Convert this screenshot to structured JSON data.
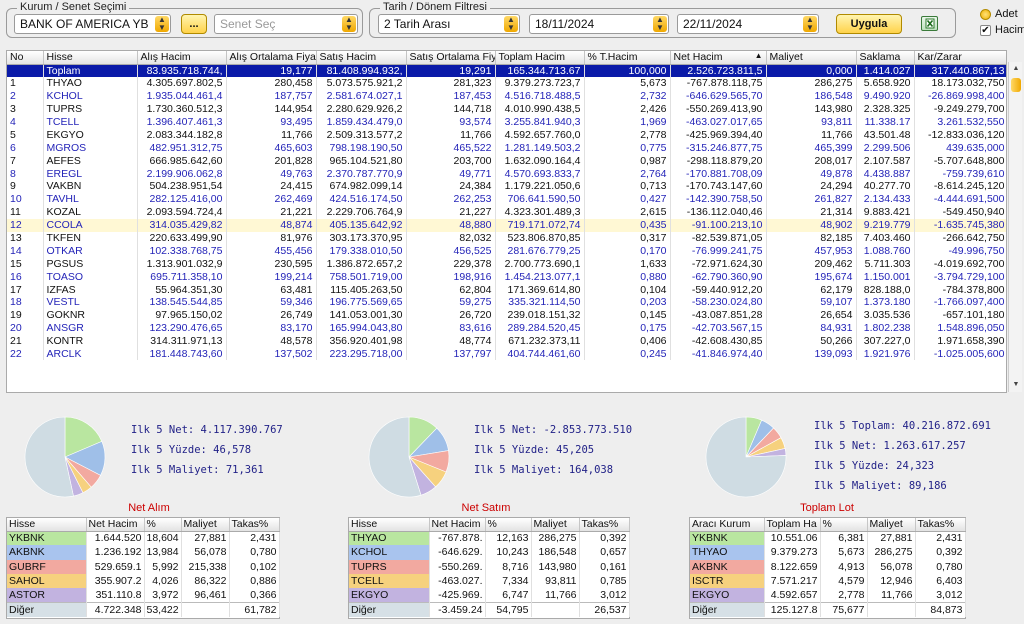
{
  "filters": {
    "kurum_legend": "Kurum / Senet Seçimi",
    "kurum_value": "BANK OF AMERICA YB",
    "dots_label": "...",
    "senet_placeholder": "Senet Seç",
    "tarih_legend": "Tarih / Dönem Filtresi",
    "range_value": "2 Tarih Arası",
    "date_from": "18/11/2024",
    "date_to": "22/11/2024",
    "apply_label": "Uygula"
  },
  "options": {
    "adet_label": "Adet",
    "hacim_label": "Hacim",
    "hacim_checked": "✔"
  },
  "grid": {
    "headers": [
      "No",
      "Hisse",
      "Alış Hacim",
      "Alış Ortalama Fiya",
      "Satış Hacim",
      "Satış Ortalama Fiy",
      "Toplam Hacim",
      "% T.Hacim",
      "Net Hacim",
      "Maliyet",
      "Saklama",
      "Kar/Zarar"
    ],
    "sort_indicator": "▲",
    "total": [
      "",
      "Toplam",
      "83.935.718.744,",
      "19,177",
      "81.408.994.932,",
      "19,291",
      "165.344.713.67",
      "100,000",
      "2.526.723.811,5",
      "0,000",
      "1.414.027",
      "317.440.867,13"
    ],
    "rows": [
      [
        "1",
        "THYAO",
        "4.305.697.802,5",
        "280,458",
        "5.073.575.921,2",
        "281,323",
        "9.379.273.723,7",
        "5,673",
        "-767.878.118,75",
        "286,275",
        "5.658.920",
        "18.173.032,750"
      ],
      [
        "2",
        "KCHOL",
        "1.935.044.461,4",
        "187,757",
        "2.581.674.027,1",
        "187,453",
        "4.516.718.488,5",
        "2,732",
        "-646.629.565,70",
        "186,548",
        "9.490.920",
        "-26.869.998,400"
      ],
      [
        "3",
        "TUPRS",
        "1.730.360.512,3",
        "144,954",
        "2.280.629.926,2",
        "144,718",
        "4.010.990.438,5",
        "2,426",
        "-550.269.413,90",
        "143,980",
        "2.328.325",
        "-9.249.279,700"
      ],
      [
        "4",
        "TCELL",
        "1.396.407.461,3",
        "93,495",
        "1.859.434.479,0",
        "93,574",
        "3.255.841.940,3",
        "1,969",
        "-463.027.017,65",
        "93,811",
        "11.338.17",
        "3.261.532,550"
      ],
      [
        "5",
        "EKGYO",
        "2.083.344.182,8",
        "11,766",
        "2.509.313.577,2",
        "11,766",
        "4.592.657.760,0",
        "2,778",
        "-425.969.394,40",
        "11,766",
        "43.501.48",
        "-12.833.036,120"
      ],
      [
        "6",
        "MGROS",
        "482.951.312,75",
        "465,603",
        "798.198.190,50",
        "465,522",
        "1.281.149.503,2",
        "0,775",
        "-315.246.877,75",
        "465,399",
        "2.299.506",
        "439.635,000"
      ],
      [
        "7",
        "AEFES",
        "666.985.642,60",
        "201,828",
        "965.104.521,80",
        "203,700",
        "1.632.090.164,4",
        "0,987",
        "-298.118.879,20",
        "208,017",
        "2.107.587",
        "-5.707.648,800"
      ],
      [
        "8",
        "EREGL",
        "2.199.906.062,8",
        "49,763",
        "2.370.787.770,9",
        "49,771",
        "4.570.693.833,7",
        "2,764",
        "-170.881.708,09",
        "49,878",
        "4.438.887",
        "-759.739,610"
      ],
      [
        "9",
        "VAKBN",
        "504.238.951,54",
        "24,415",
        "674.982.099,14",
        "24,384",
        "1.179.221.050,6",
        "0,713",
        "-170.743.147,60",
        "24,294",
        "40.277.70",
        "-8.614.245,120"
      ],
      [
        "10",
        "TAVHL",
        "282.125.416,00",
        "262,469",
        "424.516.174,50",
        "262,253",
        "706.641.590,50",
        "0,427",
        "-142.390.758,50",
        "261,827",
        "2.134.433",
        "-4.444.691,500"
      ],
      [
        "11",
        "KOZAL",
        "2.093.594.724,4",
        "21,221",
        "2.229.706.764,9",
        "21,227",
        "4.323.301.489,3",
        "2,615",
        "-136.112.040,46",
        "21,314",
        "9.883.421",
        "-549.450,940"
      ],
      [
        "12",
        "CCOLA",
        "314.035.429,82",
        "48,874",
        "405.135.642,92",
        "48,880",
        "719.171.072,74",
        "0,435",
        "-91.100.213,10",
        "48,902",
        "9.219.779",
        "-1.635.745,380"
      ],
      [
        "13",
        "TKFEN",
        "220.633.499,90",
        "81,976",
        "303.173.370,95",
        "82,032",
        "523.806.870,85",
        "0,317",
        "-82.539.871,05",
        "82,185",
        "7.403.460",
        "-266.642,750"
      ],
      [
        "14",
        "OTKAR",
        "102.338.768,75",
        "455,456",
        "179.338.010,50",
        "456,525",
        "281.676.779,25",
        "0,170",
        "-76.999.241,75",
        "457,953",
        "1.088.760",
        "-49.996,750"
      ],
      [
        "15",
        "PGSUS",
        "1.313.901.032,9",
        "230,595",
        "1.386.872.657,2",
        "229,378",
        "2.700.773.690,1",
        "1,633",
        "-72.971.624,30",
        "209,462",
        "5.711.303",
        "-4.019.692,700"
      ],
      [
        "16",
        "TOASO",
        "695.711.358,10",
        "199,214",
        "758.501.719,00",
        "198,916",
        "1.454.213.077,1",
        "0,880",
        "-62.790.360,90",
        "195,674",
        "1.150.001",
        "-3.794.729,100"
      ],
      [
        "17",
        "IZFAS",
        "55.964.351,30",
        "63,481",
        "115.405.263,50",
        "62,804",
        "171.369.614,80",
        "0,104",
        "-59.440.912,20",
        "62,179",
        "828.188,0",
        "-784.378,800"
      ],
      [
        "18",
        "VESTL",
        "138.545.544,85",
        "59,346",
        "196.775.569,65",
        "59,275",
        "335.321.114,50",
        "0,203",
        "-58.230.024,80",
        "59,107",
        "1.373.180",
        "-1.766.097,400"
      ],
      [
        "19",
        "GOKNR",
        "97.965.150,02",
        "26,749",
        "141.053.001,30",
        "26,720",
        "239.018.151,32",
        "0,145",
        "-43.087.851,28",
        "26,654",
        "3.035.536",
        "-657.101,180"
      ],
      [
        "20",
        "ANSGR",
        "123.290.476,65",
        "83,170",
        "165.994.043,80",
        "83,616",
        "289.284.520,45",
        "0,175",
        "-42.703.567,15",
        "84,931",
        "1.802.238",
        "1.548.896,050"
      ],
      [
        "21",
        "KONTR",
        "314.311.971,13",
        "48,578",
        "356.920.401,98",
        "48,774",
        "671.232.373,11",
        "0,406",
        "-42.608.430,85",
        "50,266",
        "307.227,0",
        "1.971.658,390"
      ],
      [
        "22",
        "ARCLK",
        "181.448.743,60",
        "137,502",
        "223.295.718,00",
        "137,797",
        "404.744.461,60",
        "0,245",
        "-41.846.974,40",
        "139,093",
        "1.921.976",
        "-1.025.005,600"
      ]
    ]
  },
  "panels": [
    {
      "title": "Net Alım",
      "stats": [
        "Ilk 5 Net: 4.117.390.767",
        "Ilk 5 Yüzde: 46,578",
        "Ilk 5 Maliyet: 71,361"
      ],
      "pie": [
        18.6,
        14.0,
        6.0,
        4.0,
        4.0,
        53.4
      ],
      "headers": [
        "Hisse",
        "Net Hacim",
        "%",
        "Maliyet",
        "Takas%"
      ],
      "rows": [
        [
          "YKBNK",
          "1.644.520",
          "18,604",
          "27,881",
          "2,431"
        ],
        [
          "AKBNK",
          "1.236.192",
          "13,984",
          "56,078",
          "0,780"
        ],
        [
          "GUBRF",
          "529.659.1",
          "5,992",
          "215,338",
          "0,102"
        ],
        [
          "SAHOL",
          "355.907.2",
          "4,026",
          "86,322",
          "0,886"
        ],
        [
          "ASTOR",
          "351.110.8",
          "3,972",
          "96,461",
          "0,366"
        ],
        [
          "Diğer",
          "4.722.348",
          "53,422",
          "",
          "61,782"
        ]
      ]
    },
    {
      "title": "Net Satım",
      "stats": [
        "Ilk 5 Net: -2.853.773.510",
        "Ilk 5 Yüzde: 45,205",
        "Ilk 5 Maliyet: 164,038"
      ],
      "pie": [
        12.2,
        10.2,
        8.7,
        7.3,
        6.7,
        54.8
      ],
      "headers": [
        "Hisse",
        "Net Hacim",
        "%",
        "Maliyet",
        "Takas%"
      ],
      "rows": [
        [
          "THYAO",
          "-767.878.",
          "12,163",
          "286,275",
          "0,392"
        ],
        [
          "KCHOL",
          "-646.629.",
          "10,243",
          "186,548",
          "0,657"
        ],
        [
          "TUPRS",
          "-550.269.",
          "8,716",
          "143,980",
          "0,161"
        ],
        [
          "TCELL",
          "-463.027.",
          "7,334",
          "93,811",
          "0,785"
        ],
        [
          "EKGYO",
          "-425.969.",
          "6,747",
          "11,766",
          "3,012"
        ],
        [
          "Diğer",
          "-3.459.24",
          "54,795",
          "",
          "26,537"
        ]
      ]
    },
    {
      "title": "Toplam Lot",
      "stats": [
        "Ilk 5 Toplam: 40.216.872.691",
        "Ilk 5 Net: 1.263.617.257",
        "Ilk 5 Yüzde: 24,323",
        "Ilk 5 Maliyet: 89,186"
      ],
      "pie": [
        6.4,
        5.7,
        4.9,
        4.6,
        2.8,
        75.7
      ],
      "headers": [
        "Aracı Kurum",
        "Toplam Ha",
        "%",
        "Maliyet",
        "Takas%"
      ],
      "rows": [
        [
          "YKBNK",
          "10.551.06",
          "6,381",
          "27,881",
          "2,431"
        ],
        [
          "THYAO",
          "9.379.273",
          "5,673",
          "286,275",
          "0,392"
        ],
        [
          "AKBNK",
          "8.122.659",
          "4,913",
          "56,078",
          "0,780"
        ],
        [
          "ISCTR",
          "7.571.217",
          "4,579",
          "12,946",
          "6,403"
        ],
        [
          "EKGYO",
          "4.592.657",
          "2,778",
          "11,766",
          "3,012"
        ],
        [
          "Diğer",
          "125.127.8",
          "75,677",
          "",
          "84,873"
        ]
      ]
    }
  ],
  "colors": {
    "pie": [
      "#b9e6a0",
      "#9fbfe8",
      "#f2a9a0",
      "#f6d17e",
      "#c2b3e0",
      "#cfdce3"
    ],
    "row_swatch": [
      "#b9e6a0",
      "#a9c4ee",
      "#f2a9a0",
      "#f6d17e",
      "#c2b3e0",
      "#d6e0e6"
    ],
    "total_row": "#0a1aa8",
    "stat_text": "#222288",
    "title_red": "#cc0000"
  }
}
